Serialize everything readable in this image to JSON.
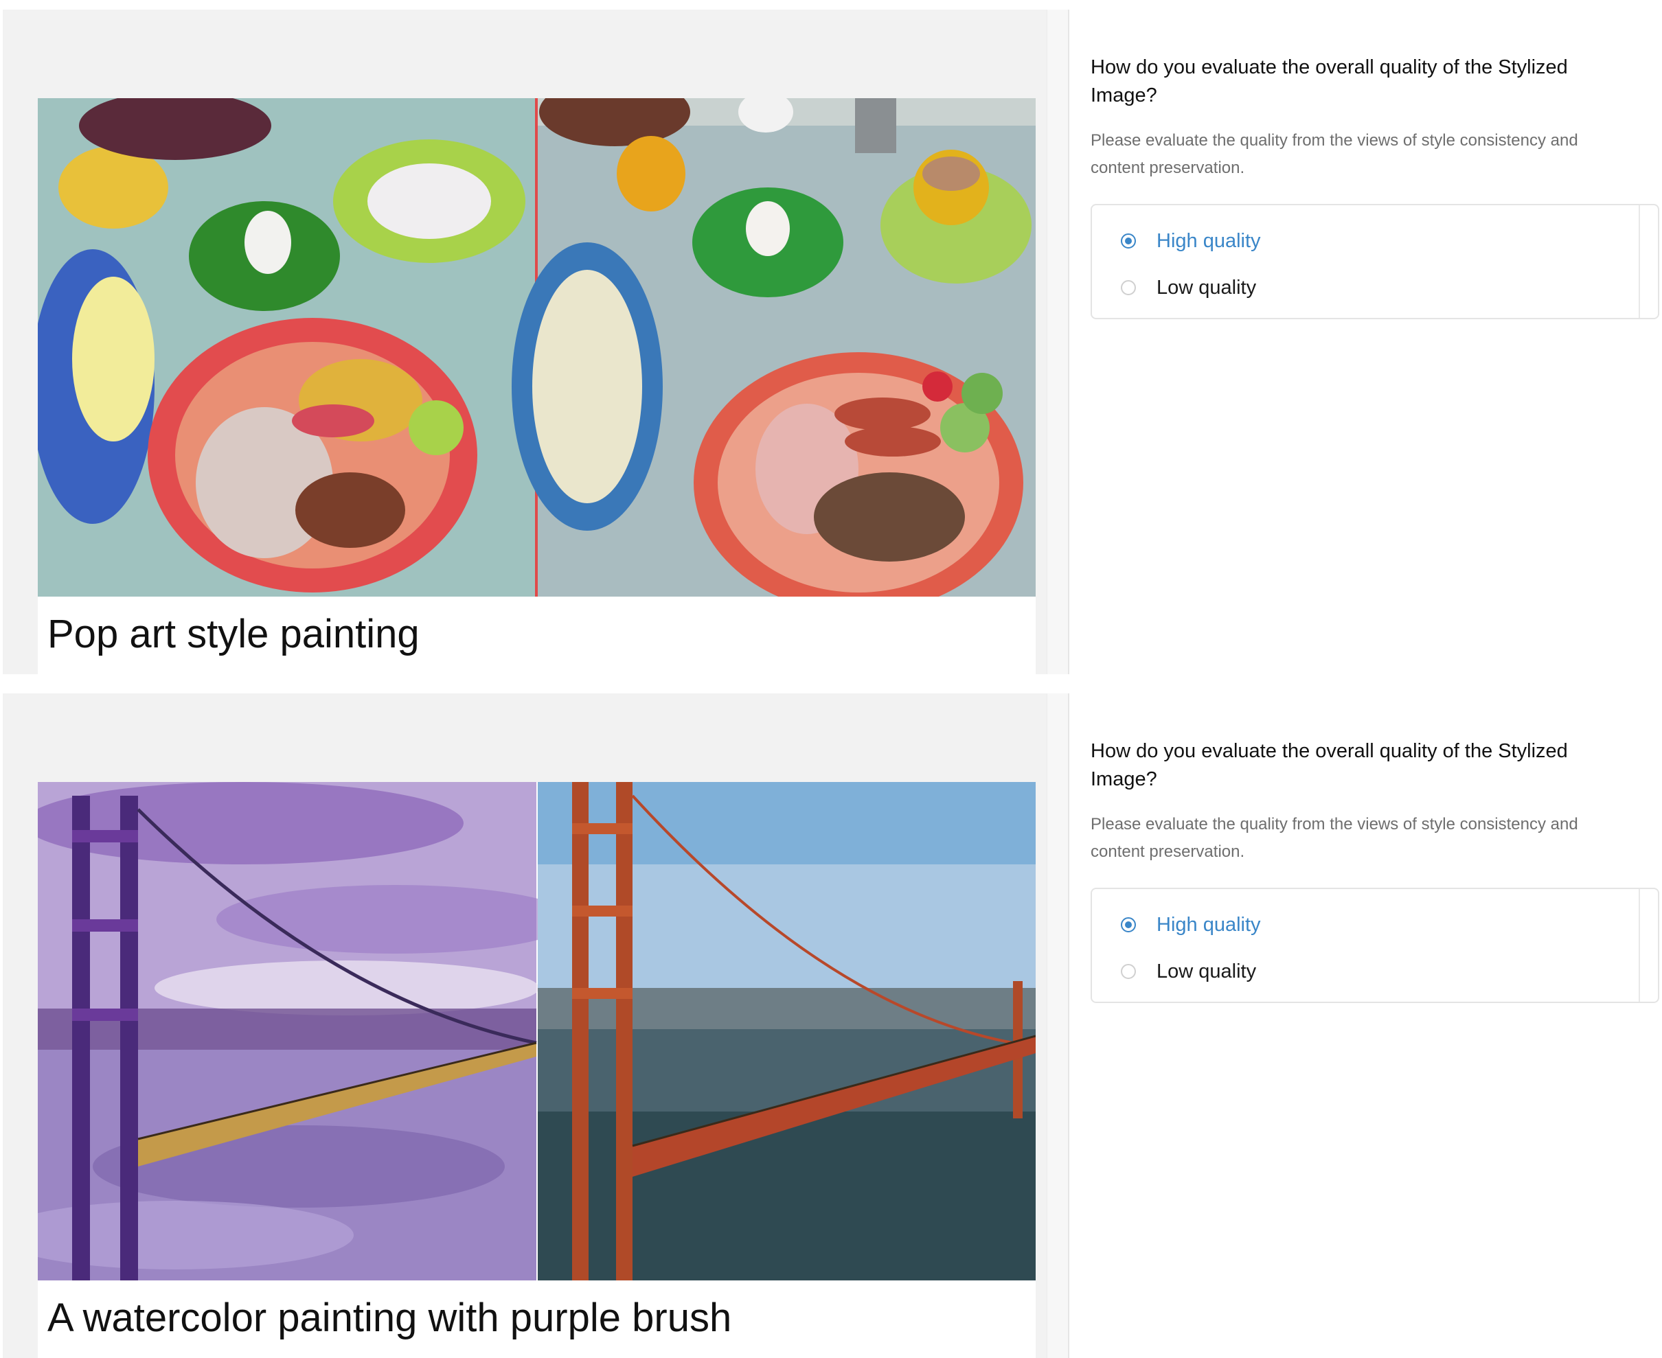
{
  "items": [
    {
      "caption": "Pop art style painting",
      "question": "How do you evaluate the overall quality of the Stylized Image?",
      "hint": "Please evaluate the quality from the views of style consistency and content preservation.",
      "options": [
        {
          "label": "High quality",
          "selected": true
        },
        {
          "label": "Low quality",
          "selected": false
        }
      ]
    },
    {
      "caption": "A watercolor painting with purple brush",
      "question": "How do you evaluate the overall quality of the Stylized Image?",
      "hint": "Please evaluate the quality from the views of style consistency and content preservation.",
      "options": [
        {
          "label": "High quality",
          "selected": true
        },
        {
          "label": "Low quality",
          "selected": false
        }
      ]
    }
  ],
  "colors": {
    "accent": "#3a86c8",
    "panel_background": "#f2f2f2"
  }
}
